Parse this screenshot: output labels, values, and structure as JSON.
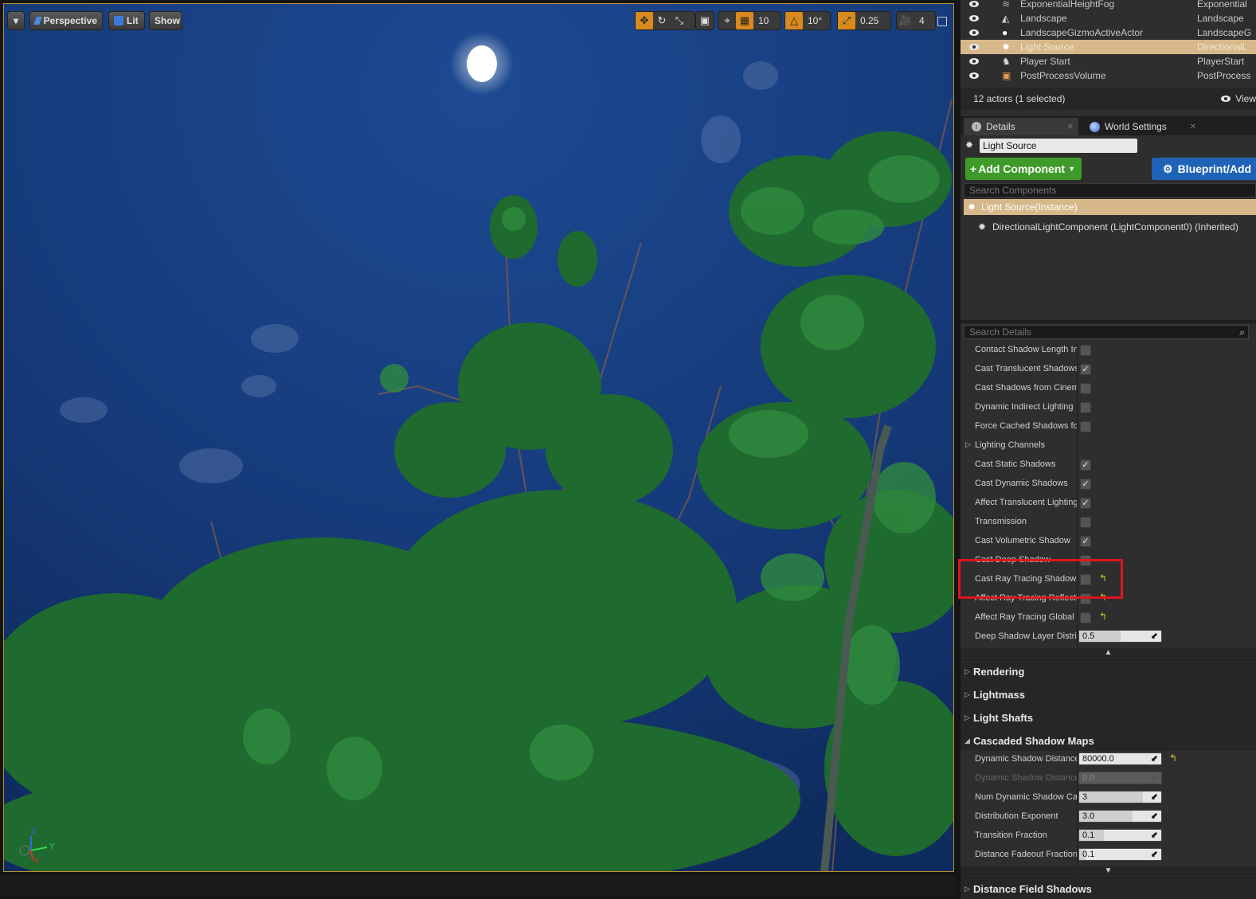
{
  "viewport": {
    "menu_arrow": "▾",
    "perspective_label": "Perspective",
    "lit_label": "Lit",
    "show_label": "Show",
    "grid_value": "10",
    "rotation_value": "10°",
    "scale_value": "0.25",
    "camera_speed": "4",
    "axis_z": "Z",
    "axis_y": "Y",
    "axis_x": "X"
  },
  "outliner": {
    "rows": [
      {
        "name": "ExponentialHeightFog",
        "type": "Exponential"
      },
      {
        "name": "Landscape",
        "type": "Landscape"
      },
      {
        "name": "LandscapeGizmoActiveActor",
        "type": "LandscapeG"
      },
      {
        "name": "Light Source",
        "type": "DirectionalL"
      },
      {
        "name": "Player Start",
        "type": "PlayerStart"
      },
      {
        "name": "PostProcessVolume",
        "type": "PostProcess"
      }
    ],
    "status": "12 actors (1 selected)",
    "view_options": "View"
  },
  "tabs": {
    "details": "Details",
    "world_settings": "World Settings"
  },
  "details": {
    "actor_name": "Light Source",
    "add_component": "Add Component",
    "blueprint": "Blueprint/Add",
    "search_components": "Search Components",
    "root_component": "Light Source(Instance)",
    "child_component": "DirectionalLightComponent (LightComponent0) (Inherited)",
    "search_details": "Search Details"
  },
  "properties": [
    {
      "label": "Contact Shadow Length In",
      "checked": false
    },
    {
      "label": "Cast Translucent Shadows",
      "checked": true
    },
    {
      "label": "Cast Shadows from Cinematic",
      "checked": false
    },
    {
      "label": "Dynamic Indirect Lighting",
      "checked": false
    },
    {
      "label": "Force Cached Shadows for",
      "checked": false
    },
    {
      "label": "Lighting Channels"
    },
    {
      "label": "Cast Static Shadows",
      "checked": true
    },
    {
      "label": "Cast Dynamic Shadows",
      "checked": true
    },
    {
      "label": "Affect Translucent Lighting",
      "checked": true
    },
    {
      "label": "Transmission",
      "checked": false
    },
    {
      "label": "Cast Volumetric Shadow",
      "checked": true
    },
    {
      "label": "Cast Deep Shadow",
      "checked": false
    },
    {
      "label": "Cast Ray Tracing Shadow",
      "checked": false
    },
    {
      "label": "Affect Ray Tracing Reflections",
      "checked": false
    },
    {
      "label": "Affect Ray Tracing Global",
      "checked": false
    },
    {
      "label": "Deep Shadow Layer Distri",
      "value": "0.5"
    }
  ],
  "categories": {
    "rendering": "Rendering",
    "lightmass": "Lightmass",
    "light_shafts": "Light Shafts",
    "cascaded": "Cascaded Shadow Maps",
    "distance_field": "Distance Field Shadows"
  },
  "cascaded_props": [
    {
      "label": "Dynamic Shadow Distance",
      "value": "80000.0"
    },
    {
      "label": "Dynamic Shadow Distance",
      "value": "0.0"
    },
    {
      "label": "Num Dynamic Shadow Ca",
      "value": "3"
    },
    {
      "label": "Distribution Exponent",
      "value": "3.0"
    },
    {
      "label": "Transition Fraction",
      "value": "0.1"
    },
    {
      "label": "Distance Fadeout Fraction",
      "value": "0.1"
    }
  ],
  "slider_fill": {
    "num_cascades": 0.78,
    "distribution_exponent": 0.65,
    "transition_fraction": 0.3,
    "distance_fadeout": 0.08,
    "deep_shadow_layer": 0.5
  },
  "colors": {
    "selection": "#d6b88a",
    "add_component": "#3e9b2a",
    "blueprint": "#1f63b8",
    "highlight_box": "#e0141e",
    "viewport_border": "#b8922e"
  }
}
